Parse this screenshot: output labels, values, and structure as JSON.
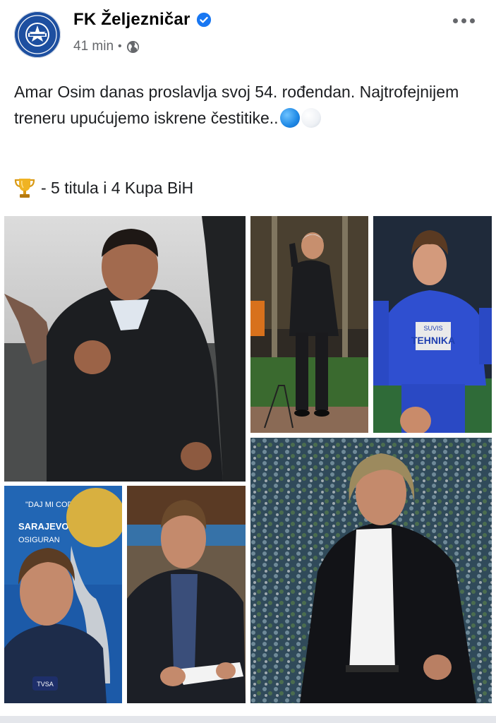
{
  "post": {
    "page_name": "FK Željezničar",
    "verified_icon": "verified-badge-icon",
    "time": "41 min",
    "separator": "•",
    "privacy_icon": "globe-icon",
    "more_icon": "more-options-icon",
    "text_line_1": "Amar Osim danas proslavlja svoj 54. rođendan. Najtrofejnijem treneru upućujemo iskrene čestitike..",
    "emoji_1": "blue-circle-icon",
    "emoji_2": "white-circle-icon",
    "trophy_icon": "trophy-icon",
    "trophy_text": "- 5 titula i 4 Kupa BiH"
  },
  "photos": {
    "photo_5_sign_1": "\"DAJ MI CODE\"",
    "photo_5_sign_2": "SARAJEVO",
    "photo_5_sign_3": "OSIGURAN",
    "photo_5_tv": "TVSA",
    "photo_3_sponsor_1": "SUVIS",
    "photo_3_sponsor_2": "TEHNIKA"
  },
  "colors": {
    "brand_blue": "#1d4fa0",
    "verified_blue": "#1877f2",
    "secondary_text": "#65676b"
  }
}
